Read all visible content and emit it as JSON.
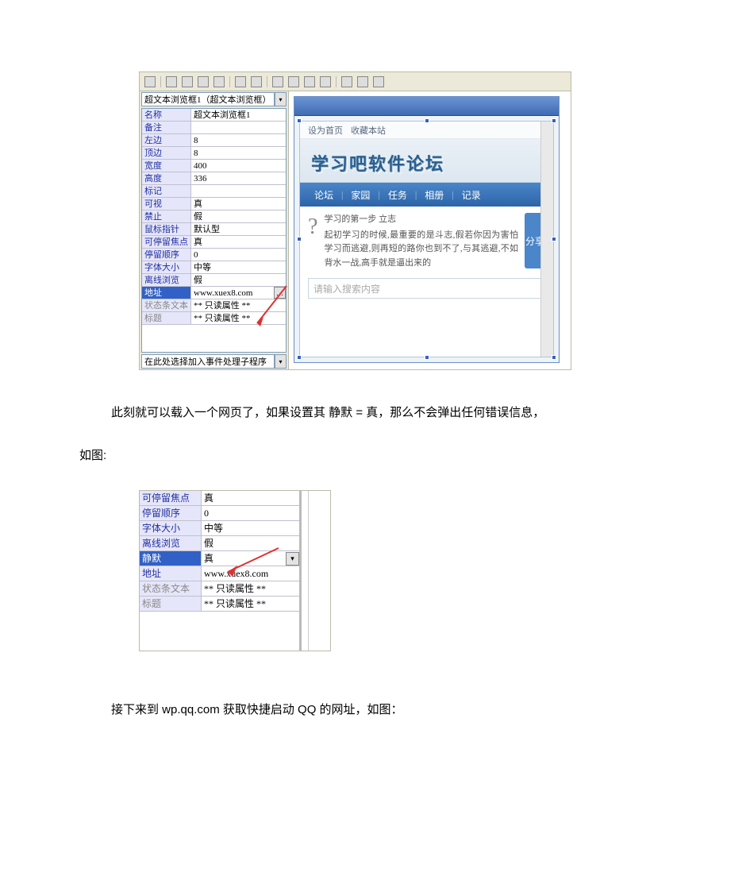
{
  "ide1": {
    "combo_label": "超文本浏览框1（超文本浏览框）",
    "event_combo": "在此处选择加入事件处理子程序",
    "properties": [
      {
        "k": "名称",
        "v": "超文本浏览框1"
      },
      {
        "k": "备注",
        "v": ""
      },
      {
        "k": "左边",
        "v": "8"
      },
      {
        "k": "顶边",
        "v": "8"
      },
      {
        "k": "宽度",
        "v": "400"
      },
      {
        "k": "高度",
        "v": "336"
      },
      {
        "k": "标记",
        "v": ""
      },
      {
        "k": "可视",
        "v": "真"
      },
      {
        "k": "禁止",
        "v": "假"
      },
      {
        "k": "鼠标指针",
        "v": "默认型"
      },
      {
        "k": "可停留焦点",
        "v": "真"
      },
      {
        "k": "停留顺序",
        "v": "0"
      },
      {
        "k": "字体大小",
        "v": "中等"
      },
      {
        "k": "离线浏览",
        "v": "假"
      },
      {
        "k": "地址",
        "v": "www.xuex8.com",
        "selected": true,
        "btn": "…"
      },
      {
        "k": "状态条文本",
        "v": "** 只读属性 **",
        "dim": true
      },
      {
        "k": "标题",
        "v": "** 只读属性 **",
        "dim": true
      }
    ]
  },
  "preview": {
    "top_links": [
      "设为首页",
      "收藏本站"
    ],
    "logo": "学习吧软件论坛",
    "nav": [
      "论坛",
      "家园",
      "任务",
      "相册",
      "记录"
    ],
    "nav_sep": "|",
    "question_mark": "?",
    "slogan_head": "学习的第一步 立志",
    "slogan_body": "起初学习的时候,最重要的是斗志,假若你因为害怕学习而逃避,则再短的路你也到不了,与其逃避,不如背水一战,高手就是逼出来的",
    "share": "分享",
    "search_ph": "请输入搜索内容"
  },
  "para1a": "此刻就可以载入一个网页了，如果设置其 静默 = 真，那么不会弹出任何错误信息，",
  "para1b": "如图:",
  "ide2": {
    "properties": [
      {
        "k": "可停留焦点",
        "v": "真"
      },
      {
        "k": "停留顺序",
        "v": "0"
      },
      {
        "k": "字体大小",
        "v": "中等"
      },
      {
        "k": "离线浏览",
        "v": "假"
      },
      {
        "k": "静默",
        "v": "真",
        "selected": true,
        "dropdown": true
      },
      {
        "k": "地址",
        "v": "www.xuex8.com"
      },
      {
        "k": "状态条文本",
        "v": "** 只读属性 **",
        "dim": true
      },
      {
        "k": "标题",
        "v": "** 只读属性 **",
        "dim": true
      }
    ]
  },
  "para2": "接下来到 wp.qq.com 获取快捷启动 QQ 的网址，如图："
}
